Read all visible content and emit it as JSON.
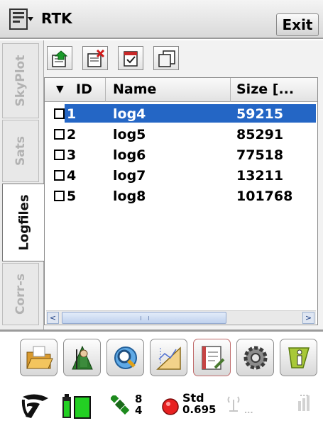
{
  "window": {
    "title": "RTK",
    "exit_label": "Exit"
  },
  "tabs": [
    {
      "label": "SkyPlot",
      "active": false
    },
    {
      "label": "Sats",
      "active": false
    },
    {
      "label": "Logfiles",
      "active": true
    },
    {
      "label": "Corr-s",
      "active": false
    }
  ],
  "toolbar": {
    "icons": [
      "upload-log-icon",
      "delete-log-icon",
      "check-log-icon",
      "copy-log-icon"
    ]
  },
  "table": {
    "columns": [
      "ID",
      "Name",
      "Size [..."
    ],
    "rows": [
      {
        "id": "1",
        "name": "log4",
        "size": "59215",
        "selected": true,
        "checked": false
      },
      {
        "id": "2",
        "name": "log5",
        "size": "85291",
        "selected": false,
        "checked": false
      },
      {
        "id": "3",
        "name": "log6",
        "size": "77518",
        "selected": false,
        "checked": false
      },
      {
        "id": "4",
        "name": "log7",
        "size": "13211",
        "selected": false,
        "checked": false
      },
      {
        "id": "5",
        "name": "log8",
        "size": "101768",
        "selected": false,
        "checked": false
      }
    ],
    "scroll_left": "<",
    "scroll_right": ">"
  },
  "bottom_buttons": [
    "open-folder-icon",
    "survey-icon",
    "search-icon",
    "cad-drawing-icon",
    "notebook-icon",
    "settings-gear-icon",
    "info-icon"
  ],
  "status": {
    "sats_top": "8",
    "sats_bottom": "4",
    "solution_label": "Std",
    "solution_value": "0.695",
    "radio_text": "...",
    "signal_text": "..."
  },
  "colors": {
    "selection": "#2466c5",
    "tab_inactive_text": "#b2b2b2"
  }
}
